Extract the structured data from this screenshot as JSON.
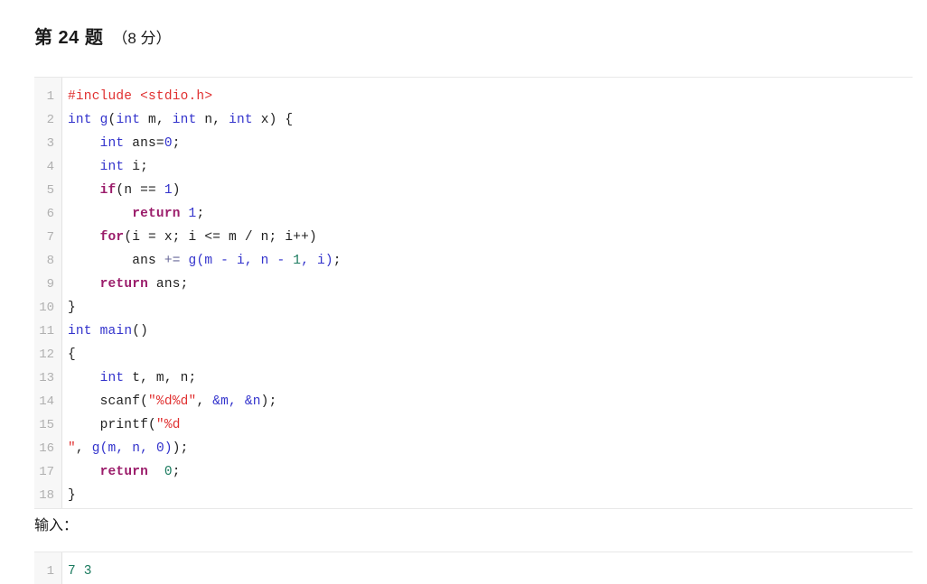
{
  "question": {
    "title": "第 24 题",
    "score": "（8 分）"
  },
  "colors": {
    "preprocessor": "#e03030",
    "string": "#e03030",
    "keyword": "#9b1d6b",
    "type": "#3333cc",
    "number_green": "#1a7a5e",
    "number_blue": "#3333cc",
    "plain": "#1f1f1f",
    "gutter_bg": "#f7f7f7",
    "gutter_text": "#b0b0b0",
    "block_border": "#e8e8e8"
  },
  "code_block": {
    "language": "c",
    "line_numbers": [
      "1",
      "2",
      "3",
      "4",
      "5",
      "6",
      "7",
      "8",
      "9",
      "10",
      "11",
      "12",
      "13",
      "14",
      "15",
      "16",
      "17",
      "18"
    ],
    "lines": [
      "#include <stdio.h>",
      "int g(int m, int n, int x) {",
      "    int ans=0;",
      "    int i;",
      "    if(n == 1)",
      "        return 1;",
      "    for(i = x; i <= m / n; i++)",
      "        ans += g(m - i, n - 1, i);",
      "    return ans;",
      "}",
      "int main()",
      "{",
      "    int t, m, n;",
      "    scanf(\"%d%d\", &m, &n);",
      "    printf(\"%d",
      "\", g(m, n, 0));",
      "    return  0;",
      "}"
    ]
  },
  "input_section": {
    "label": "输入：",
    "line_numbers": [
      "1"
    ],
    "lines": [
      "7 3"
    ]
  }
}
